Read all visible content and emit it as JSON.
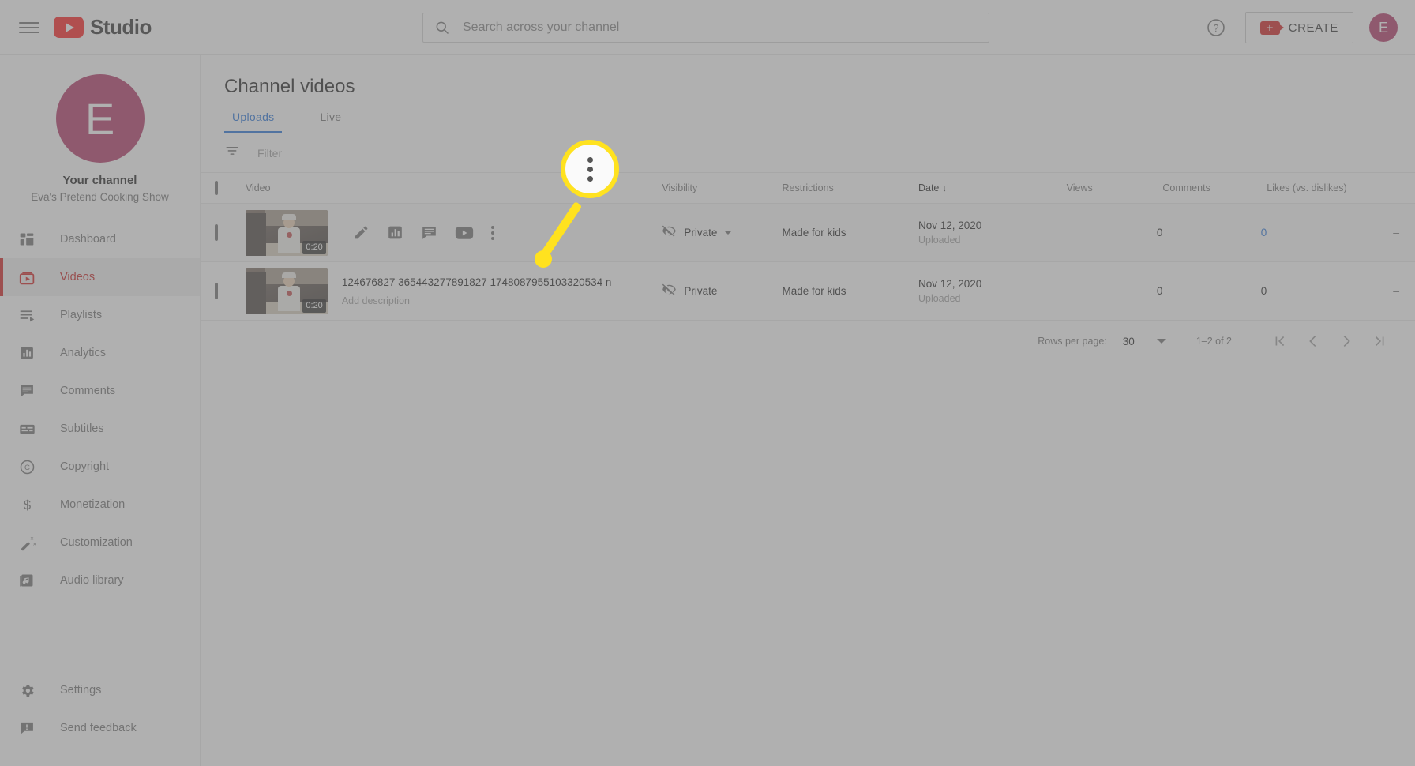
{
  "topbar": {
    "menu_icon": "hamburger-icon",
    "logo_text": "Studio",
    "search_placeholder": "Search across your channel",
    "search_value": "",
    "help_icon": "help-circle-icon",
    "create_label": "CREATE",
    "avatar_initial": "E"
  },
  "sidebar": {
    "avatar_initial": "E",
    "channel_label": "Your channel",
    "channel_name": "Eva's Pretend Cooking Show",
    "items": [
      {
        "label": "Dashboard",
        "icon": "dashboard-icon",
        "active": false
      },
      {
        "label": "Videos",
        "icon": "videos-icon",
        "active": true
      },
      {
        "label": "Playlists",
        "icon": "playlists-icon",
        "active": false
      },
      {
        "label": "Analytics",
        "icon": "analytics-icon",
        "active": false
      },
      {
        "label": "Comments",
        "icon": "comments-icon",
        "active": false
      },
      {
        "label": "Subtitles",
        "icon": "subtitles-icon",
        "active": false
      },
      {
        "label": "Copyright",
        "icon": "copyright-icon",
        "active": false
      },
      {
        "label": "Monetization",
        "icon": "monetization-icon",
        "active": false
      },
      {
        "label": "Customization",
        "icon": "customization-icon",
        "active": false
      },
      {
        "label": "Audio library",
        "icon": "audio-library-icon",
        "active": false
      }
    ],
    "bottom_items": [
      {
        "label": "Settings",
        "icon": "gear-icon"
      },
      {
        "label": "Send feedback",
        "icon": "feedback-icon"
      }
    ]
  },
  "main": {
    "page_title": "Channel videos",
    "tabs": [
      {
        "label": "Uploads",
        "active": true
      },
      {
        "label": "Live",
        "active": false
      }
    ],
    "filter": {
      "icon": "filter-icon",
      "placeholder": "Filter",
      "value": ""
    },
    "columns": [
      {
        "key": "video",
        "label": "Video"
      },
      {
        "key": "visibility",
        "label": "Visibility"
      },
      {
        "key": "restrictions",
        "label": "Restrictions"
      },
      {
        "key": "date",
        "label": "Date",
        "sorted": true,
        "sort_dir": "desc",
        "sort_glyph": "↓"
      },
      {
        "key": "views",
        "label": "Views"
      },
      {
        "key": "comments",
        "label": "Comments"
      },
      {
        "key": "likes",
        "label": "Likes (vs. dislikes)"
      }
    ],
    "rows": [
      {
        "selected": false,
        "hovered": true,
        "duration": "0:20",
        "title": "",
        "description": "",
        "hover_actions": [
          {
            "name": "edit-details-icon"
          },
          {
            "name": "analytics-icon"
          },
          {
            "name": "comments-icon"
          },
          {
            "name": "watch-on-youtube-icon"
          },
          {
            "name": "more-options-icon"
          }
        ],
        "visibility": "Private",
        "visibility_has_caret": true,
        "restrictions": "Made for kids",
        "date": "Nov 12, 2020",
        "date_sub": "Uploaded",
        "views": "0",
        "comments": "0",
        "comments_is_link": true,
        "likes": "–"
      },
      {
        "selected": false,
        "hovered": false,
        "duration": "0:20",
        "title": "124676827 365443277891827 1748087955103320534 n",
        "description": "Add description",
        "hover_actions": [],
        "visibility": "Private",
        "visibility_has_caret": false,
        "restrictions": "Made for kids",
        "date": "Nov 12, 2020",
        "date_sub": "Uploaded",
        "views": "0",
        "comments": "0",
        "comments_is_link": false,
        "likes": "–"
      }
    ],
    "pagination": {
      "rows_per_page_label": "Rows per page:",
      "rows_per_page_value": "30",
      "range": "1–2 of 2",
      "first_icon": "first-page-icon",
      "prev_icon": "prev-page-icon",
      "next_icon": "next-page-icon",
      "last_icon": "last-page-icon"
    }
  },
  "annotation": {
    "target": "more-options-icon",
    "callout_glyph": "kebab-menu",
    "color": "#ffe21f"
  },
  "colors": {
    "accent_red": "#cc0000",
    "link_blue": "#065fd4",
    "avatar": "#a81c51",
    "highlight": "#ffe21f"
  }
}
